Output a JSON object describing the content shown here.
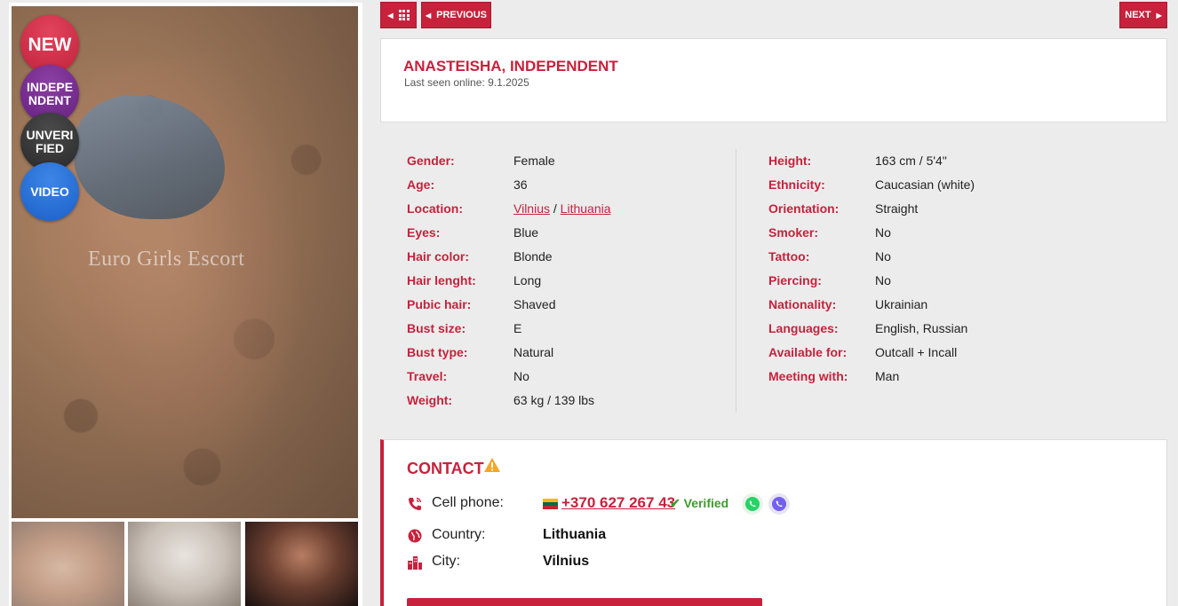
{
  "nav": {
    "grid_label": "",
    "previous_label": "PREVIOUS",
    "next_label": "NEXT"
  },
  "profile": {
    "title": "ANASTEISHA, INDEPENDENT",
    "last_seen": "Last seen online: 9.1.2025"
  },
  "gallery": {
    "watermark": "Euro Girls Escort",
    "badges": {
      "new": "NEW",
      "independent_line1": "INDEPE",
      "independent_line2": "NDENT",
      "unverified_line1": "UNVERI",
      "unverified_line2": "FIED",
      "video": "VIDEO"
    }
  },
  "details_left": [
    {
      "label": "Gender:",
      "value": "Female"
    },
    {
      "label": "Age:",
      "value": "36"
    },
    {
      "label": "Location:",
      "value_city": "Vilnius",
      "value_sep": " / ",
      "value_country": "Lithuania"
    },
    {
      "label": "Eyes:",
      "value": "Blue"
    },
    {
      "label": "Hair color:",
      "value": "Blonde"
    },
    {
      "label": "Hair lenght:",
      "value": "Long"
    },
    {
      "label": "Pubic hair:",
      "value": "Shaved"
    },
    {
      "label": "Bust size:",
      "value": "E"
    },
    {
      "label": "Bust type:",
      "value": "Natural"
    },
    {
      "label": "Travel:",
      "value": "No"
    },
    {
      "label": "Weight:",
      "value": "63 kg / 139 lbs"
    }
  ],
  "details_right": [
    {
      "label": "Height:",
      "value": "163 cm / 5'4\""
    },
    {
      "label": "Ethnicity:",
      "value": "Caucasian (white)"
    },
    {
      "label": "Orientation:",
      "value": "Straight"
    },
    {
      "label": "Smoker:",
      "value": "No"
    },
    {
      "label": "Tattoo:",
      "value": "No"
    },
    {
      "label": "Piercing:",
      "value": "No"
    },
    {
      "label": "Nationality:",
      "value": "Ukrainian"
    },
    {
      "label": "Languages:",
      "value": "English, Russian"
    },
    {
      "label": "Available for:",
      "value": "Outcall + Incall"
    },
    {
      "label": "Meeting with:",
      "value": "Man"
    }
  ],
  "contact": {
    "title": "CONTACT",
    "cell_label": "Cell phone:",
    "phone": "+370 627 267 43",
    "verified": "Verified",
    "country_label": "Country:",
    "country": "Lithuania",
    "city_label": "City:",
    "city": "Vilnius"
  },
  "colors": {
    "accent": "#c8213c",
    "verified": "#3f9b2e",
    "whatsapp": "#25d366",
    "viber": "#7360f2"
  },
  "icons": [
    "grid-icon",
    "chevron-left-icon",
    "chevron-right-icon",
    "warning-icon",
    "phone-icon",
    "globe-icon",
    "city-icon",
    "lithuania-flag-icon",
    "checkmark-icon",
    "whatsapp-icon",
    "viber-icon"
  ]
}
